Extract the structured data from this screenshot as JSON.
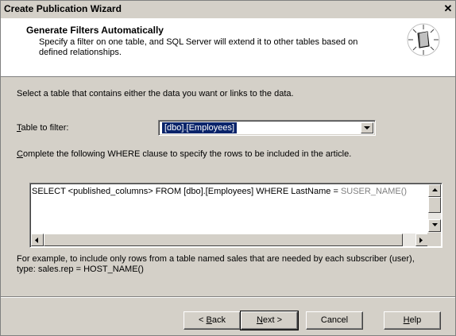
{
  "window": {
    "title": "Create Publication Wizard",
    "close_glyph": "✕"
  },
  "header": {
    "title": "Generate Filters Automatically",
    "description": "Specify a filter on one table, and SQL Server will extend it to other tables based on defined relationships.",
    "icon": "wizard-book-icon"
  },
  "intro_text": "Select a table that contains either the data you want or links to the data.",
  "table_filter": {
    "label_mnemonic": "T",
    "label_rest": "able to filter:",
    "value": "[dbo].[Employees]"
  },
  "where_label": {
    "mnemonic": "C",
    "rest": "omplete the following WHERE clause to specify the rows to be included in the article."
  },
  "where_clause": {
    "main": "SELECT <published_columns> FROM [dbo].[Employees] WHERE LastName = ",
    "function": "SUSER_NAME()"
  },
  "example_text": "For example, to include only rows from a table named sales that are needed by each subscriber (user), type: sales.rep = HOST_NAME()",
  "buttons": {
    "back": {
      "prefix": "< ",
      "mnemonic": "B",
      "rest": "ack"
    },
    "next": {
      "mnemonic": "N",
      "rest": "ext >"
    },
    "cancel": "Cancel",
    "help": {
      "mnemonic": "H",
      "rest": "elp"
    }
  },
  "colors": {
    "dialog_bg": "#d4d0c8",
    "selection": "#0a246a",
    "function_text": "#808080"
  }
}
